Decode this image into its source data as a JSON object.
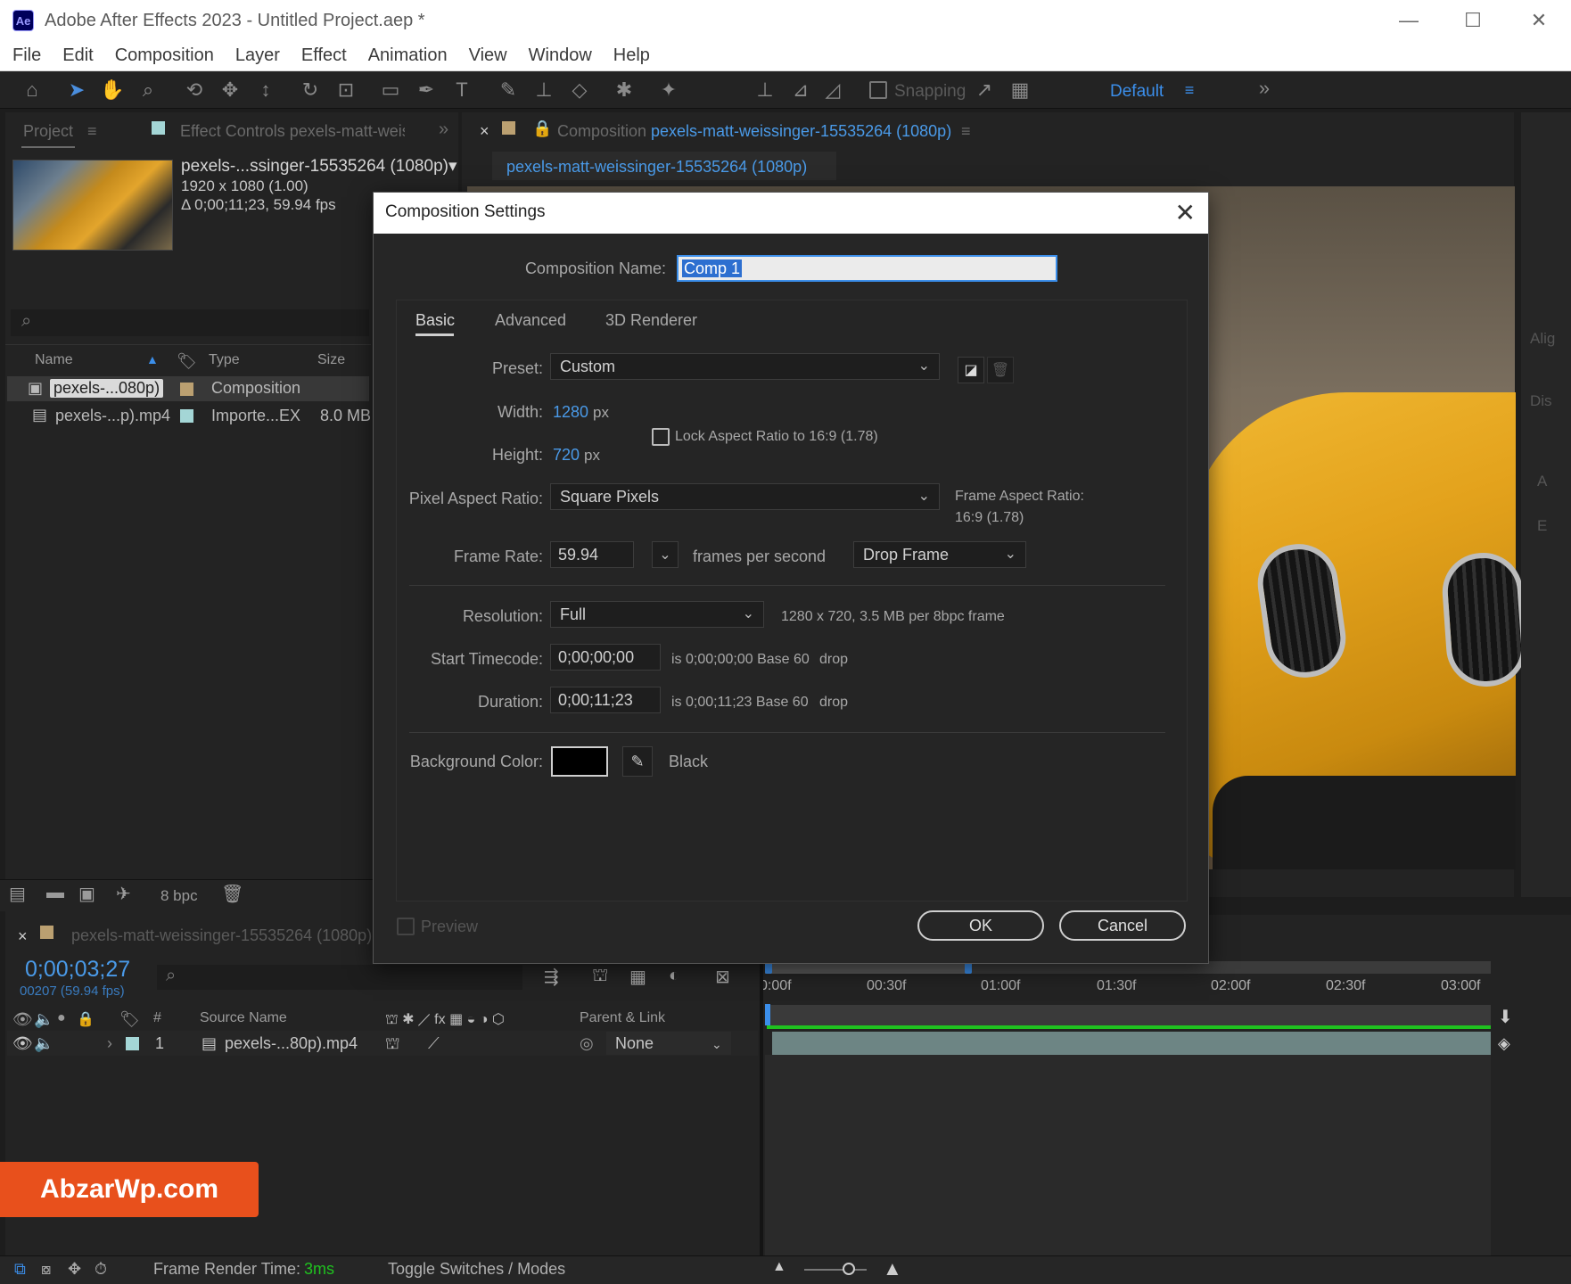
{
  "window": {
    "icon_text": "Ae",
    "title": "Adobe After Effects 2023 - Untitled Project.aep *",
    "minimize": "—",
    "maximize": "☐",
    "close": "✕"
  },
  "menu": [
    "File",
    "Edit",
    "Composition",
    "Layer",
    "Effect",
    "Animation",
    "View",
    "Window",
    "Help"
  ],
  "toolbar": {
    "snapping_label": "Snapping",
    "workspace_label": "Default",
    "workspace_menu": "≡",
    "overflow": "»"
  },
  "project_panel": {
    "tab_project": "Project",
    "tab_menu": "≡",
    "tab_effect_controls": "Effect Controls pexels-matt-weis",
    "overflow": "»",
    "item_name": "pexels-...ssinger-15535264 (1080p)▾",
    "item_dims": "1920 x 1080 (1.00)",
    "item_duration": "Δ 0;00;11;23, 59.94 fps",
    "search_icon": "⌕",
    "columns": {
      "name": "Name",
      "type": "Type",
      "size": "Size"
    },
    "rows": [
      {
        "name": "pexels-...080p)",
        "type": "Composition",
        "size": "",
        "label_color": "#bba071"
      },
      {
        "name": "pexels-...p).mp4",
        "type": "Importe...EX",
        "size": "8.0 MB",
        "label_color": "#a4d6d6"
      }
    ],
    "footer_bpc": "8 bpc"
  },
  "viewer": {
    "tab_close": "×",
    "tab_label": "Composition",
    "tab_comp": "pexels-matt-weissinger-15535264 (1080p)",
    "tab_menu": "≡",
    "breadcrumb": "pexels-matt-weissinger-15535264 (1080p)"
  },
  "right_panel": {
    "items": [
      "Alig",
      "Dis",
      "A",
      "E"
    ]
  },
  "dialog": {
    "title": "Composition Settings",
    "close": "✕",
    "name_label": "Composition Name:",
    "name_value": "Comp 1",
    "tabs": [
      "Basic",
      "Advanced",
      "3D Renderer"
    ],
    "preset_label": "Preset:",
    "preset_value": "Custom",
    "width_label": "Width:",
    "width_value": "1280",
    "height_label": "Height:",
    "height_value": "720",
    "px_unit": "px",
    "lock_label": "Lock Aspect Ratio to 16:9 (1.78)",
    "par_label": "Pixel Aspect Ratio:",
    "par_value": "Square Pixels",
    "far_label": "Frame Aspect Ratio:",
    "far_value": "16:9 (1.78)",
    "framerate_label": "Frame Rate:",
    "framerate_value": "59.94",
    "fps_label": "frames per second",
    "drop_frame_value": "Drop Frame",
    "resolution_label": "Resolution:",
    "resolution_value": "Full",
    "resolution_info": "1280 x 720, 3.5 MB per 8bpc frame",
    "start_tc_label": "Start Timecode:",
    "start_tc_value": "0;00;00;00",
    "start_tc_info": "is 0;00;00;00  Base 60",
    "start_tc_drop": "drop",
    "duration_label": "Duration:",
    "duration_value": "0;00;11;23",
    "duration_info": "is 0;00;11;23  Base 60",
    "duration_drop": "drop",
    "bg_label": "Background Color:",
    "bg_name": "Black",
    "bg_color": "#000000",
    "preview_label": "Preview",
    "ok": "OK",
    "cancel": "Cancel"
  },
  "timeline": {
    "tab_close": "×",
    "tab_label": "pexels-matt-weissinger-15535264 (1080p)",
    "timecode": "0;00;03;27",
    "frame_count": "00207 (59.94 fps)",
    "ruler": [
      "0:00f",
      "00:30f",
      "01:00f",
      "01:30f",
      "02:00f",
      "02:30f",
      "03:00f"
    ],
    "columns": {
      "num": "#",
      "source": "Source Name",
      "parent": "Parent & Link"
    },
    "layer": {
      "num": "1",
      "name": "pexels-...80p).mp4",
      "parent": "None",
      "label_color": "#a4d6d6"
    }
  },
  "status": {
    "render_label": "Frame Render Time:",
    "render_value": "3ms",
    "toggle_modes": "Toggle Switches / Modes"
  },
  "watermark": "AbzarWp.com"
}
